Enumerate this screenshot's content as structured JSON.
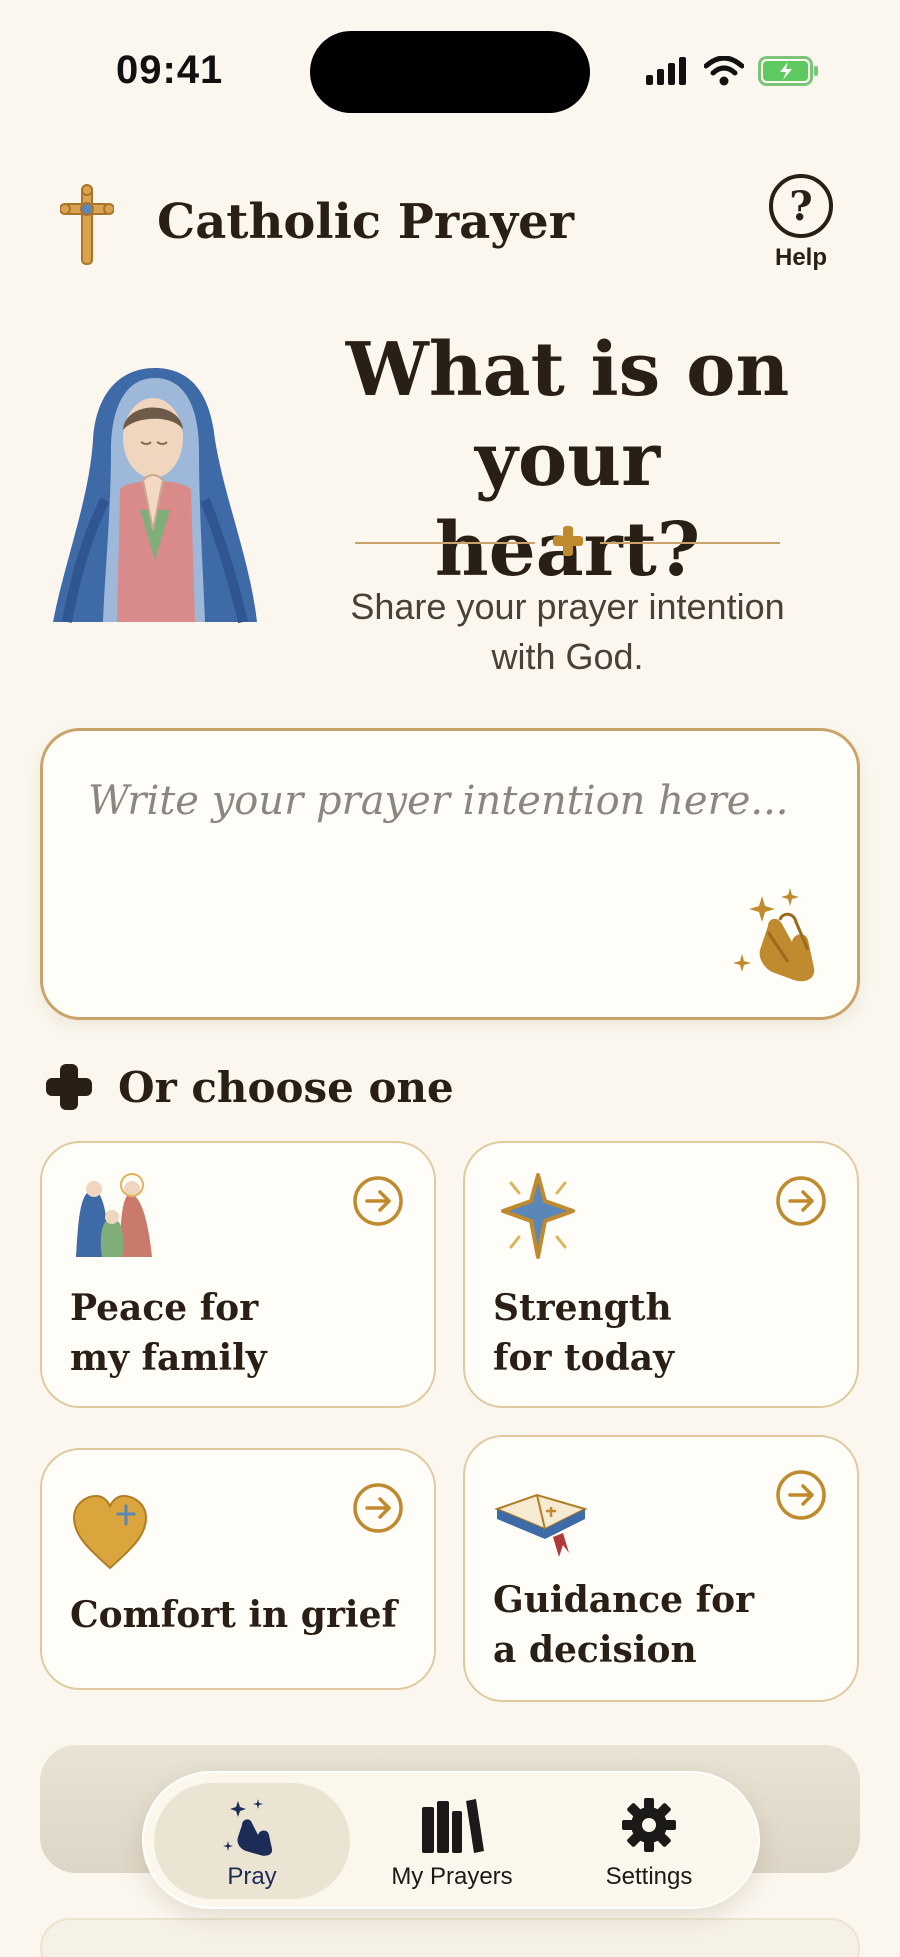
{
  "status_bar": {
    "time": "09:41"
  },
  "header": {
    "title": "Catholic Prayer",
    "help_label": "Help",
    "help_glyph": "?"
  },
  "hero": {
    "title_line1": "What is on",
    "title_line2": "your heart?",
    "subtitle_line1": "Share your prayer intention",
    "subtitle_line2": "with God."
  },
  "intention": {
    "placeholder": "Write your prayer intention here...",
    "value": ""
  },
  "choose": {
    "title": "Or choose one",
    "cards": [
      {
        "label": "Peace for\nmy family",
        "icon": "holy-family-icon"
      },
      {
        "label": "Strength\nfor today",
        "icon": "glowing-cross-icon"
      },
      {
        "label": "Comfort in grief",
        "icon": "golden-heart-icon"
      },
      {
        "label": "Guidance for\na decision",
        "icon": "open-bible-icon"
      }
    ]
  },
  "nav": {
    "items": [
      {
        "label": "Pray",
        "active": true
      },
      {
        "label": "My Prayers",
        "active": false
      },
      {
        "label": "Settings",
        "active": false
      }
    ]
  },
  "colors": {
    "accent_gold": "#c08a2e",
    "border_gold": "#c9a36a",
    "background": "#fbf7ef",
    "text_dark": "#2a1f14",
    "active_nav_text": "#1d2b57"
  }
}
